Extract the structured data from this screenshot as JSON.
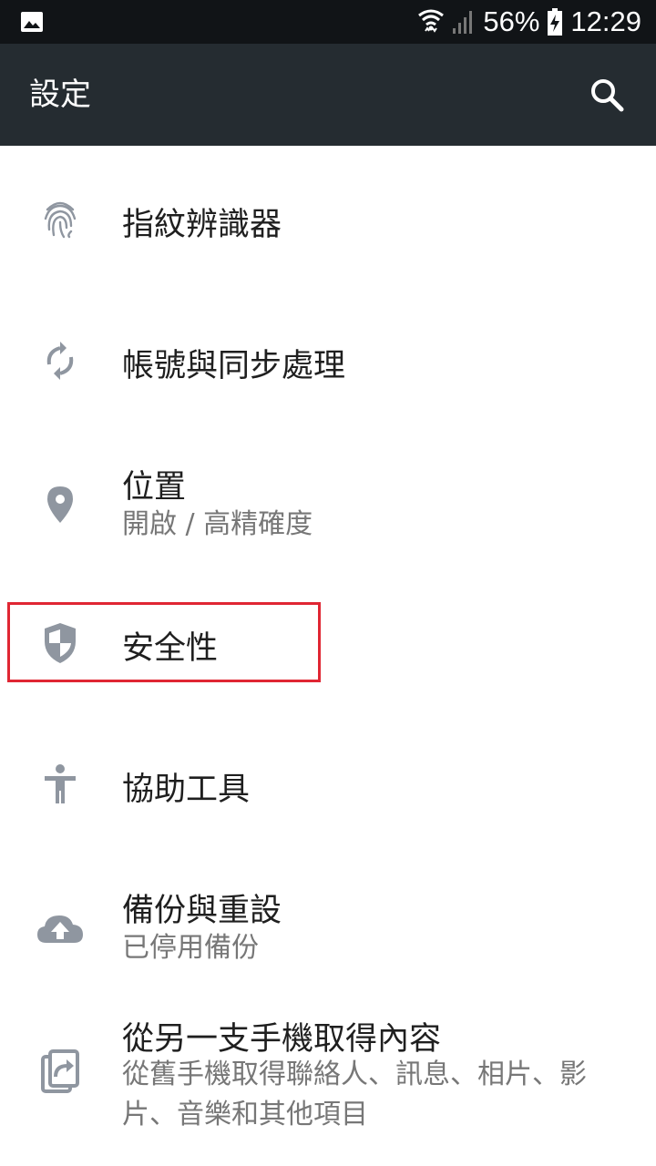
{
  "status_bar": {
    "battery": "56%",
    "time": "12:29",
    "icons": [
      "image-icon",
      "wifi-icon",
      "cell-signal-icon",
      "battery-charging-icon"
    ]
  },
  "app_bar": {
    "title": "設定",
    "search_icon": "search-icon"
  },
  "items": [
    {
      "icon": "fingerprint-icon",
      "title": "指紋辨識器",
      "subtitle": ""
    },
    {
      "icon": "sync-icon",
      "title": "帳號與同步處理",
      "subtitle": ""
    },
    {
      "icon": "location-pin-icon",
      "title": "位置",
      "subtitle": "開啟 / 高精確度"
    },
    {
      "icon": "shield-icon",
      "title": "安全性",
      "subtitle": ""
    },
    {
      "icon": "accessibility-icon",
      "title": "協助工具",
      "subtitle": ""
    },
    {
      "icon": "cloud-upload-icon",
      "title": "備份與重設",
      "subtitle": "已停用備份"
    },
    {
      "icon": "transfer-content-icon",
      "title": "從另一支手機取得內容",
      "subtitle": "從舊手機取得聯絡人、訊息、相片、影片、音樂和其他項目"
    }
  ],
  "colors": {
    "status_bar": "#111417",
    "app_bar": "#252c31",
    "icon": "#8f96a0",
    "highlight": "#e02633"
  }
}
